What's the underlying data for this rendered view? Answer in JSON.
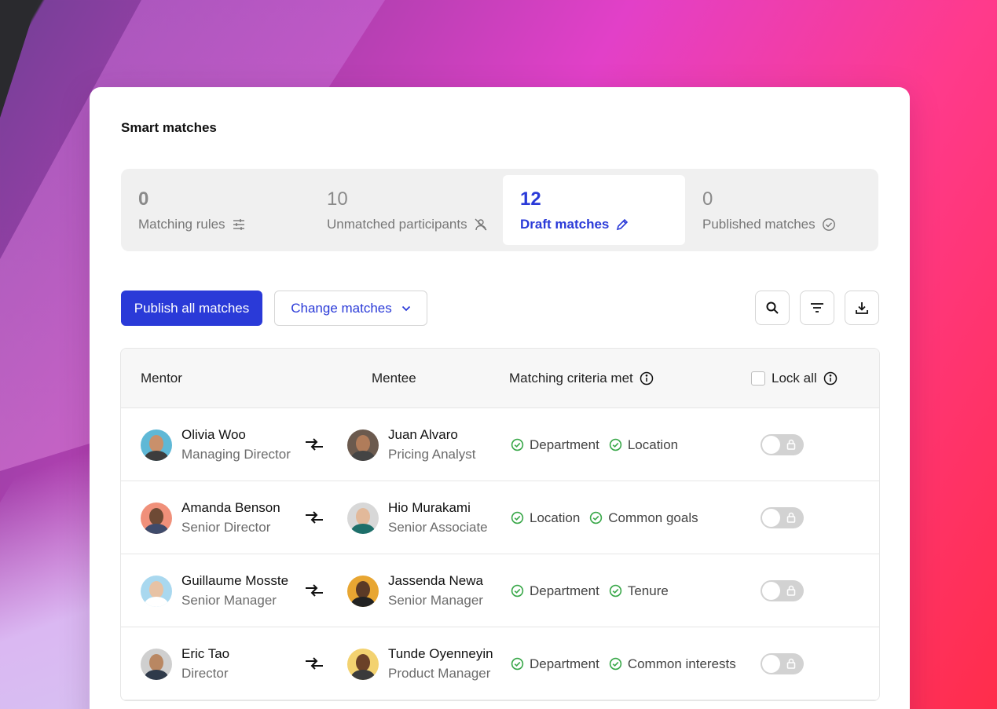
{
  "title": "Smart matches",
  "stats": [
    {
      "value": "0",
      "label": "Matching rules",
      "icon": "sliders-icon"
    },
    {
      "value": "10",
      "label": "Unmatched participants",
      "icon": "user-off-icon"
    },
    {
      "value": "12",
      "label": "Draft matches",
      "icon": "pencil-icon",
      "active": true
    },
    {
      "value": "0",
      "label": "Published matches",
      "icon": "check-circle-icon"
    }
  ],
  "toolbar": {
    "publish_label": "Publish all matches",
    "change_label": "Change matches"
  },
  "table": {
    "headers": {
      "mentor": "Mentor",
      "mentee": "Mentee",
      "criteria": "Matching criteria met",
      "lock_all": "Lock all"
    },
    "rows": [
      {
        "mentor": {
          "name": "Olivia Woo",
          "role": "Managing Director"
        },
        "mentee": {
          "name": "Juan Alvaro",
          "role": "Pricing Analyst"
        },
        "criteria": [
          "Department",
          "Location"
        ]
      },
      {
        "mentor": {
          "name": "Amanda Benson",
          "role": "Senior Director"
        },
        "mentee": {
          "name": "Hio Murakami",
          "role": "Senior Associate"
        },
        "criteria": [
          "Location",
          "Common goals"
        ]
      },
      {
        "mentor": {
          "name": "Guillaume Mosste",
          "role": "Senior Manager"
        },
        "mentee": {
          "name": "Jassenda Newa",
          "role": "Senior Manager"
        },
        "criteria": [
          "Department",
          "Tenure"
        ]
      },
      {
        "mentor": {
          "name": "Eric Tao",
          "role": "Director"
        },
        "mentee": {
          "name": "Tunde Oyenneyin",
          "role": "Product Manager"
        },
        "criteria": [
          "Department",
          "Common interests"
        ]
      }
    ]
  },
  "colors": {
    "accent": "#2a3ad8",
    "check_green": "#3aa84a",
    "toggle_off": "#d2d2d2"
  }
}
